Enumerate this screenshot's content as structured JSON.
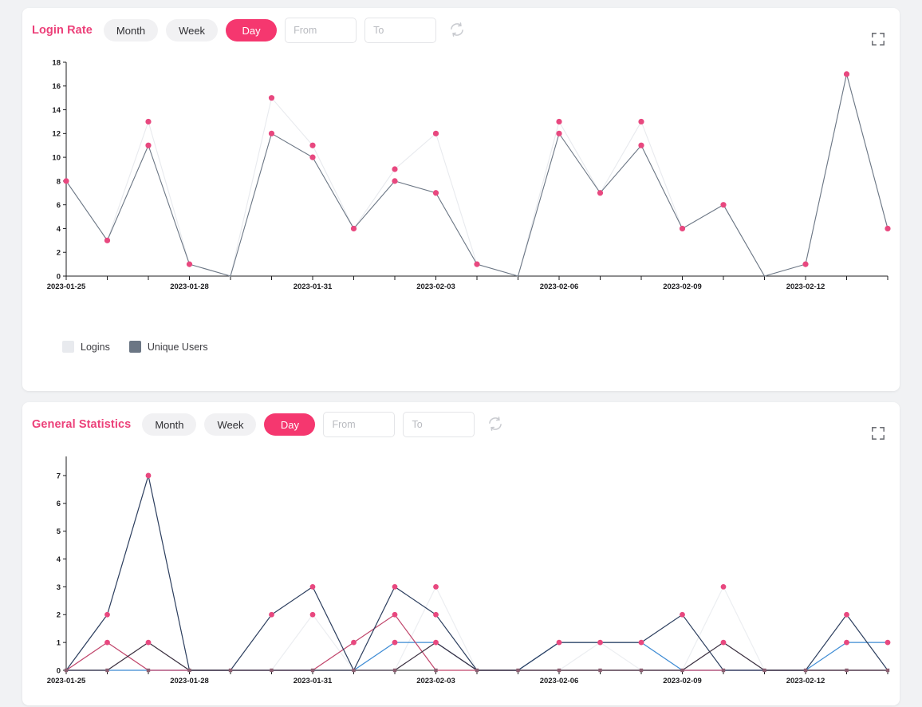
{
  "theme": {
    "page_bg": "#f1f2f4",
    "card_bg": "#ffffff",
    "accent_pink": "#ec4079",
    "active_pill": "#f5376f",
    "pill_bg": "#f1f1f3",
    "marker_pink": "#e8487f",
    "logins_color": "#e8eaee",
    "unique_users_color": "#6b7684",
    "series_navy": "#2c3e5e",
    "series_crimson": "#c0456b",
    "series_blue": "#3d8bd4",
    "series_light": "#eceef1"
  },
  "cards": [
    {
      "id": "login-rate",
      "title": "Login Rate",
      "controls": {
        "range_buttons": [
          {
            "label": "Month",
            "active": false
          },
          {
            "label": "Week",
            "active": false
          },
          {
            "label": "Day",
            "active": true
          }
        ],
        "from_value": "",
        "from_placeholder": "From",
        "to_value": "",
        "to_placeholder": "To",
        "refresh_icon": "refresh-icon",
        "expand_icon": "fullscreen-expand-icon"
      },
      "legend": [
        {
          "label": "Logins",
          "color": "#e8eaee"
        },
        {
          "label": "Unique Users",
          "color": "#6b7684"
        }
      ]
    },
    {
      "id": "general-statistics",
      "title": "General Statistics",
      "controls": {
        "range_buttons": [
          {
            "label": "Month",
            "active": false
          },
          {
            "label": "Week",
            "active": false
          },
          {
            "label": "Day",
            "active": true
          }
        ],
        "from_value": "",
        "from_placeholder": "From",
        "to_value": "",
        "to_placeholder": "To",
        "refresh_icon": "refresh-icon",
        "expand_icon": "fullscreen-expand-icon"
      },
      "legend": []
    }
  ],
  "chart_data": [
    {
      "type": "line",
      "title": "Login Rate",
      "xlabel": "",
      "ylabel": "",
      "ylim": [
        0,
        18
      ],
      "yticks": [
        0,
        2,
        4,
        6,
        8,
        10,
        12,
        14,
        16,
        18
      ],
      "grid": false,
      "legend_position": "bottom-left",
      "x": [
        "2023-01-25",
        "2023-01-26",
        "2023-01-27",
        "2023-01-28",
        "2023-01-29",
        "2023-01-30",
        "2023-01-31",
        "2023-02-01",
        "2023-02-02",
        "2023-02-03",
        "2023-02-04",
        "2023-02-05",
        "2023-02-06",
        "2023-02-07",
        "2023-02-08",
        "2023-02-09",
        "2023-02-10",
        "2023-02-11",
        "2023-02-12",
        "2023-02-13",
        "2023-02-14"
      ],
      "xtick_labels": [
        "2023-01-25",
        "",
        "",
        "2023-01-28",
        "",
        "",
        "2023-01-31",
        "",
        "",
        "2023-02-03",
        "",
        "",
        "2023-02-06",
        "",
        "",
        "2023-02-09",
        "",
        "",
        "2023-02-12",
        "",
        ""
      ],
      "series": [
        {
          "name": "Logins",
          "color": "#e8eaee",
          "values": [
            8,
            3,
            13,
            1,
            0,
            15,
            11,
            4,
            9,
            12,
            1,
            0,
            13,
            7,
            13,
            4,
            6,
            0,
            1,
            17,
            4
          ]
        },
        {
          "name": "Unique Users",
          "color": "#6b7684",
          "values": [
            8,
            3,
            11,
            1,
            0,
            12,
            10,
            4,
            8,
            7,
            1,
            0,
            12,
            7,
            11,
            4,
            6,
            0,
            1,
            17,
            4
          ]
        }
      ]
    },
    {
      "type": "line",
      "title": "General Statistics",
      "xlabel": "",
      "ylabel": "",
      "ylim": [
        0,
        7.4
      ],
      "yticks": [
        0,
        1,
        2,
        3,
        4,
        5,
        6,
        7
      ],
      "grid": false,
      "legend_position": "none",
      "x": [
        "2023-01-25",
        "2023-01-26",
        "2023-01-27",
        "2023-01-28",
        "2023-01-29",
        "2023-01-30",
        "2023-01-31",
        "2023-02-01",
        "2023-02-02",
        "2023-02-03",
        "2023-02-04",
        "2023-02-05",
        "2023-02-06",
        "2023-02-07",
        "2023-02-08",
        "2023-02-09",
        "2023-02-10",
        "2023-02-11",
        "2023-02-12",
        "2023-02-13",
        "2023-02-14"
      ],
      "xtick_labels": [
        "2023-01-25",
        "",
        "",
        "2023-01-28",
        "",
        "",
        "2023-01-31",
        "",
        "",
        "2023-02-03",
        "",
        "",
        "2023-02-06",
        "",
        "",
        "2023-02-09",
        "",
        "",
        "2023-02-12",
        "",
        ""
      ],
      "series": [
        {
          "name": "series-navy",
          "color": "#2c3e5e",
          "values": [
            0,
            2,
            7,
            0,
            0,
            2,
            3,
            0,
            3,
            2,
            0,
            0,
            1,
            1,
            1,
            2,
            0,
            0,
            0,
            2,
            0
          ]
        },
        {
          "name": "series-crimson",
          "color": "#c0456b",
          "values": [
            0,
            1,
            0,
            0,
            0,
            0,
            0,
            1,
            2,
            0,
            0,
            0,
            0,
            0,
            0,
            0,
            0,
            0,
            0,
            0,
            0
          ]
        },
        {
          "name": "series-dark",
          "color": "#3a2f3f",
          "values": [
            0,
            0,
            1,
            0,
            0,
            0,
            0,
            0,
            0,
            1,
            0,
            0,
            0,
            0,
            0,
            0,
            1,
            0,
            0,
            0,
            0
          ]
        },
        {
          "name": "series-blue",
          "color": "#3d8bd4",
          "values": [
            0,
            0,
            0,
            0,
            0,
            0,
            0,
            0,
            1,
            1,
            0,
            0,
            1,
            1,
            1,
            0,
            0,
            0,
            0,
            1,
            1
          ]
        },
        {
          "name": "series-light",
          "color": "#eceef1",
          "values": [
            0,
            0,
            0,
            0,
            0,
            0,
            2,
            0,
            0,
            3,
            0,
            0,
            0,
            1,
            0,
            0,
            3,
            0,
            0,
            0,
            0
          ]
        }
      ]
    }
  ]
}
